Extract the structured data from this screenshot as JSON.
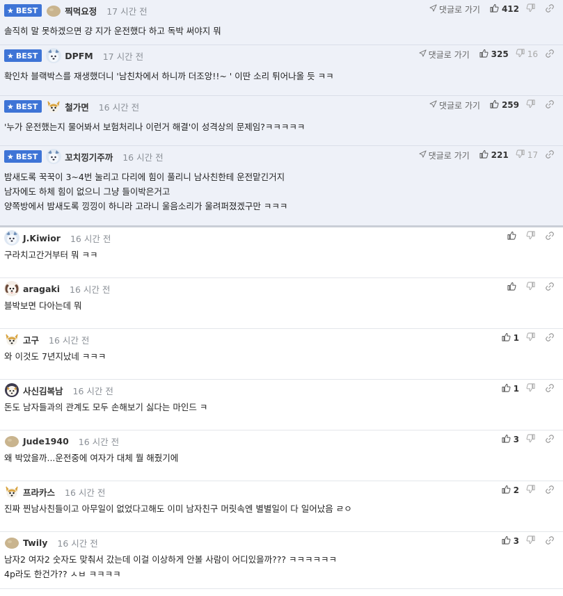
{
  "labels": {
    "best_badge": "BEST",
    "reply_link": "댓글로 가기"
  },
  "colors": {
    "best_background": "#eef1f8",
    "best_badge": "#3e74d6",
    "time_text": "#8a8f96"
  },
  "comments": [
    {
      "best": true,
      "avatar": "potato",
      "nickname": "찍먹요정",
      "time": "17 시간 전",
      "lines": [
        "솔직히 말 못하겠으면 걍 지가 운전했다 하고 독박 써야지 뭐"
      ],
      "likes": "412",
      "dislikes": ""
    },
    {
      "best": true,
      "avatar": "blue-dog",
      "nickname": "DPFM",
      "time": "17 시간 전",
      "lines": [
        "확인차 블랙박스를 재생했더니 '남친차에서 하니까 더조앙!!~ ' 이딴 소리 튀어나올 듯 ㅋㅋ"
      ],
      "likes": "325",
      "dislikes": "16"
    },
    {
      "best": true,
      "avatar": "corgi",
      "nickname": "철가면",
      "time": "16 시간 전",
      "lines": [
        "'누가 운전했는지 물어봐서 보험처리나 이런거 해결'이 성격상의 문제임?ㅋㅋㅋㅋㅋ"
      ],
      "likes": "259",
      "dislikes": ""
    },
    {
      "best": true,
      "avatar": "blue-dog",
      "nickname": "꼬치낑기주까",
      "time": "16 시간 전",
      "lines": [
        "밤새도록 꾹꾹이 3~4번 눌리고 다리에 힘이 풀리니 남사친한테 운전맡긴거지",
        "남자에도 하체 힘이 없으니 그냥 들이박은거고",
        "양쪽방에서 밤새도록 낑낑이 하니라 고라니 울음소리가 울려퍼졌겠구만 ㅋㅋㅋ"
      ],
      "likes": "221",
      "dislikes": "17"
    },
    {
      "best": false,
      "avatar": "blue-dog",
      "nickname": "J.Kiwior",
      "time": "16 시간 전",
      "lines": [
        "구라치고간거부터 뭐 ㅋㅋ"
      ],
      "likes": "",
      "dislikes": ""
    },
    {
      "best": false,
      "avatar": "puppy",
      "nickname": "aragaki",
      "time": "16 시간 전",
      "lines": [
        "블박보면 다아는데 뭐"
      ],
      "likes": "",
      "dislikes": ""
    },
    {
      "best": false,
      "avatar": "corgi",
      "nickname": "고구",
      "time": "16 시간 전",
      "lines": [
        "와 이것도 7년지났네 ㅋㅋㅋ"
      ],
      "likes": "1",
      "dislikes": ""
    },
    {
      "best": false,
      "avatar": "lion",
      "nickname": "사신김복남",
      "time": "16 시간 전",
      "lines": [
        "돈도 남자들과의 관계도 모두 손해보기 싫다는 마인드 ㅋ"
      ],
      "likes": "1",
      "dislikes": ""
    },
    {
      "best": false,
      "avatar": "potato",
      "nickname": "Jude1940",
      "time": "16 시간 전",
      "lines": [
        "왜 박았을까...운전중에 여자가 대체 뭘 해줬기에"
      ],
      "likes": "3",
      "dislikes": ""
    },
    {
      "best": false,
      "avatar": "corgi",
      "nickname": "프라카스",
      "time": "16 시간 전",
      "lines": [
        "진짜 찐남사친들이고 아무일이 없었다고해도 이미 남자친구 머릿속엔 별별일이 다 일어났음 ㄹㅇ"
      ],
      "likes": "2",
      "dislikes": ""
    },
    {
      "best": false,
      "avatar": "potato",
      "nickname": "Twily",
      "time": "16 시간 전",
      "lines": [
        "남자2 여자2 숫자도 맞춰서 갔는데 이걸 이상하게 안볼 사람이 어디있을까??? ㅋㅋㅋㅋㅋㅋ",
        "4p라도 한건가?? ㅅㅂ ㅋㅋㅋㅋ"
      ],
      "likes": "3",
      "dislikes": ""
    }
  ]
}
